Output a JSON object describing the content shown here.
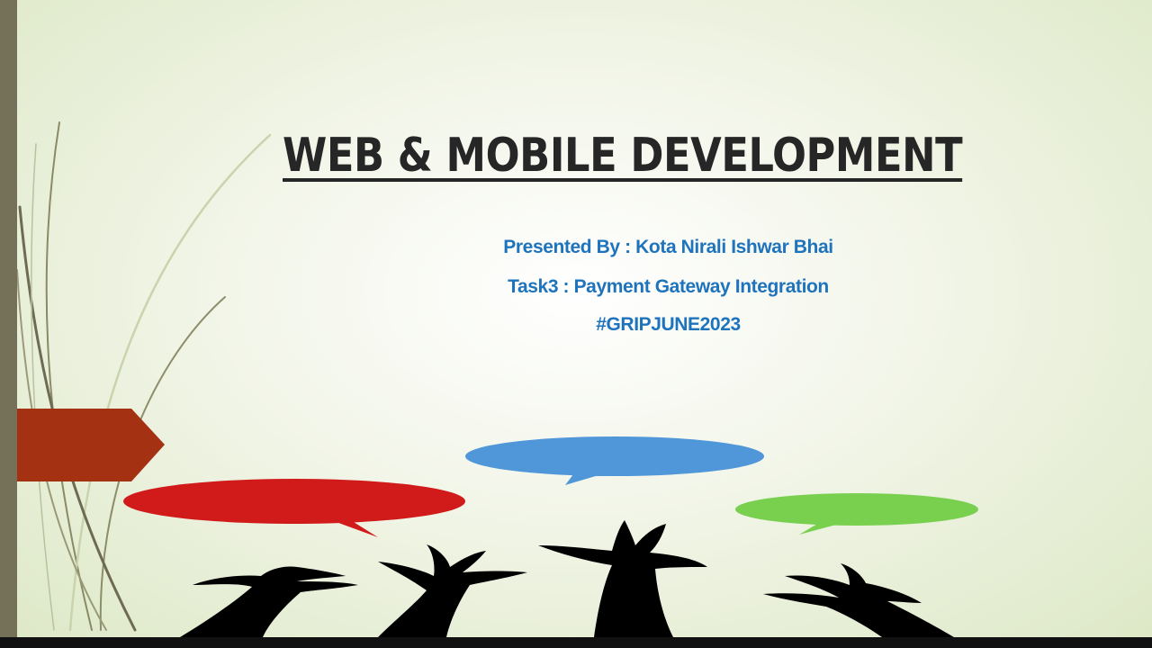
{
  "slide": {
    "title": "WEB & MOBILE DEVELOPMENT",
    "subtitle_lines": [
      "Presented By : Kota Nirali Ishwar Bhai",
      "Task3 : Payment Gateway Integration",
      "#GRIPJUNE2023"
    ]
  },
  "colors": {
    "title": "#262626",
    "subtitle": "#1e73bd",
    "arrow_tab": "#a33112",
    "bubble_red": "#d11b1b",
    "bubble_blue": "#4f97d9",
    "bubble_green": "#78d04e",
    "silhouette": "#000000",
    "side_bar": "#757158"
  },
  "icons": [
    "arrow-tab-shape",
    "speech-bubble-red",
    "speech-bubble-blue",
    "speech-bubble-green",
    "raised-hands-silhouette",
    "grass-blades"
  ]
}
